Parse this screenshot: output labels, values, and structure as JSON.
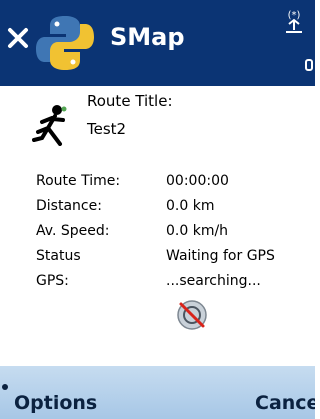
{
  "app": {
    "title": "SMap"
  },
  "route": {
    "title_label": "Route Title:",
    "title_value": "Test2"
  },
  "stats": [
    {
      "label": "Route Time:",
      "value": "00:00:00"
    },
    {
      "label": "Distance:",
      "value": "0.0 km"
    },
    {
      "label": "Av. Speed:",
      "value": "0.0 km/h"
    },
    {
      "label": "Status",
      "value": "Waiting for GPS"
    },
    {
      "label": "GPS:",
      "value": "...searching..."
    }
  ],
  "softkeys": {
    "left": "Options",
    "right": "Cance"
  },
  "colors": {
    "titlebar": "#0b3474",
    "softbar": "#b8d3ec",
    "text": "#000000"
  },
  "icons": {
    "close": "close-icon",
    "logo": "python-logo-icon",
    "bluetooth": "bluetooth-icon",
    "runner": "runner-icon",
    "gps": "gps-off-icon"
  }
}
